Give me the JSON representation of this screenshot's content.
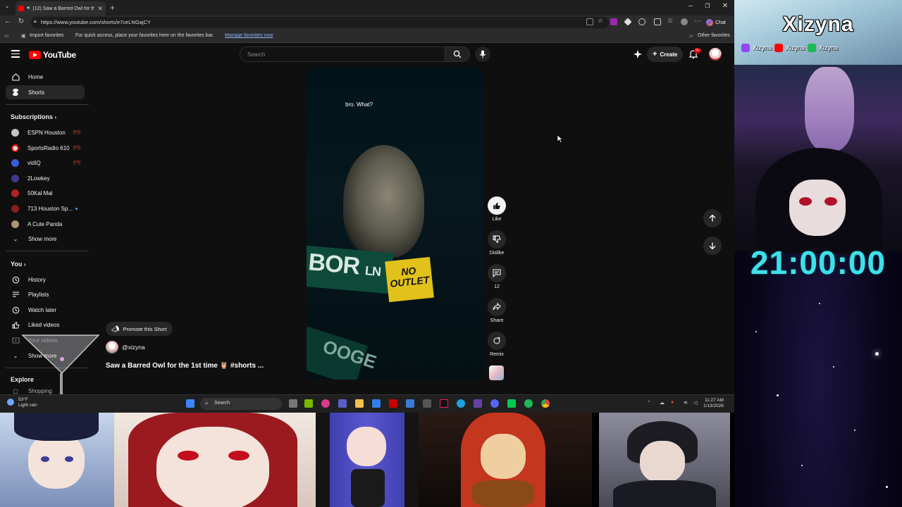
{
  "browser": {
    "tab_title": "(12) Saw a Barred Owl for the",
    "url": "https://www.youtube.com/shorts/e7ceLNGajCY",
    "chat_label": "Chat",
    "favorites": {
      "import_label": "Import favorites",
      "hint": "For quick access, place your favorites here on the favorites bar.",
      "manage_link": "Manage favorites now",
      "other": "Other favorites"
    }
  },
  "youtube": {
    "logo_text": "YouTube",
    "search_placeholder": "Search",
    "create_label": "Create",
    "notif_count": "9+",
    "sidebar": {
      "main": [
        {
          "label": "Home",
          "icon": "home-icon"
        },
        {
          "label": "Shorts",
          "icon": "shorts-icon",
          "active": true
        }
      ],
      "subscriptions_heading": "Subscriptions",
      "subscriptions": [
        {
          "label": "ESPN Houston",
          "color": "#c4c4c4",
          "status": "live"
        },
        {
          "label": "SportsRadio 610",
          "color": "#d6d6d6",
          "status": "live"
        },
        {
          "label": "vidIQ",
          "color": "#3b5bdb",
          "status": "live"
        },
        {
          "label": "2Lowkey",
          "color": "#3d3a8a",
          "status": ""
        },
        {
          "label": "50Kal Mal",
          "color": "#b12323",
          "status": ""
        },
        {
          "label": "713 Houston Sp...",
          "color": "#8a1f1f",
          "status": "dot"
        },
        {
          "label": "A Cute Panda",
          "color": "#a89870",
          "status": ""
        }
      ],
      "show_more": "Show more",
      "you_heading": "You",
      "you_items": [
        {
          "label": "History",
          "icon": "history-icon"
        },
        {
          "label": "Playlists",
          "icon": "playlists-icon"
        },
        {
          "label": "Watch later",
          "icon": "watch-later-icon"
        },
        {
          "label": "Liked videos",
          "icon": "liked-videos-icon"
        },
        {
          "label": "Your videos",
          "icon": "your-videos-icon"
        },
        {
          "label": "Show more",
          "icon": "chevron-down-icon"
        }
      ],
      "explore_heading": "Explore",
      "explore_items": [
        {
          "label": "Shopping"
        }
      ]
    },
    "short": {
      "caption": "bro. What?",
      "sign_main": "BOR",
      "sign_suffix": "LN",
      "sign_no": "NO",
      "sign_outlet": "OUTLET",
      "sign_lower": "OOGE",
      "promote_label": "Promote this Short",
      "channel": "@xizyna",
      "title": "Saw a Barred Owl for the 1st time 🦉 #shorts ..."
    },
    "actions": {
      "like": "Like",
      "dislike": "Dislike",
      "comments": "12",
      "share": "Share",
      "remix": "Remix"
    }
  },
  "taskbar": {
    "temp": "53°F",
    "weather": "Light rain",
    "search_label": "Search",
    "time": "11:27 AM",
    "date": "1/13/2026"
  },
  "overlay": {
    "streamer_name": "Xizyna",
    "social_handle": "Xizyna",
    "timer": "21:00:00"
  },
  "colors": {
    "youtube_red": "#ff0000",
    "timer_cyan": "#3fe0e8",
    "link_blue": "#8ab4f8"
  }
}
